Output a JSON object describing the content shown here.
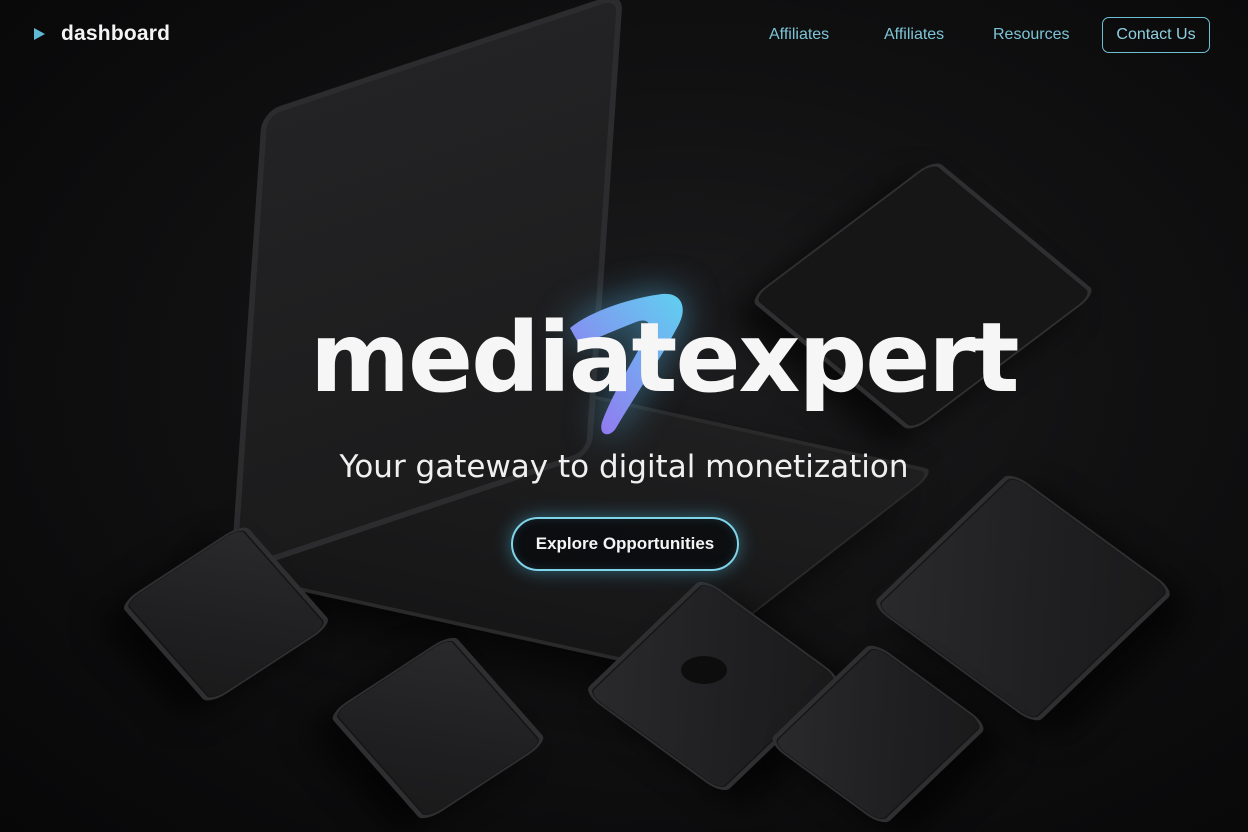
{
  "nav": {
    "brand_label": "dashboard",
    "brand_icon": "play-icon",
    "links": [
      {
        "label": "Affiliates"
      },
      {
        "label": "Affiliates"
      },
      {
        "label": "Resources"
      }
    ],
    "contact_label": "Contact Us"
  },
  "hero": {
    "logo_text": "mediatexpert",
    "tagline": "Your gateway to digital monetization",
    "cta_label": "Explore Opportunities"
  },
  "colors": {
    "accent": "#6fbfd3",
    "background": "#0b0b0c",
    "logo_gradient_start": "#5fd0f0",
    "logo_gradient_end": "#9a6cf0"
  }
}
